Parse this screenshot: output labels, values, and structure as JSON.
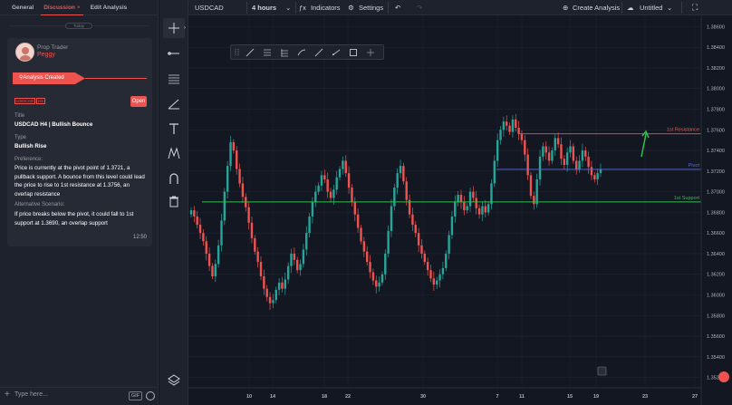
{
  "left_panel": {
    "tabs": [
      {
        "label": "General"
      },
      {
        "label": "Discussion",
        "close": "×"
      },
      {
        "label": "Edit Analysis"
      }
    ],
    "date_pill": "Today",
    "card": {
      "role": "Prop Trader",
      "username": "Peggy",
      "banner": "Analysis Created",
      "tags": [
        "USDCAD",
        "H4"
      ],
      "open_label": "Open",
      "title_label": "Title",
      "title_value": "USDCAD H4 | Bullish Bounce",
      "type_label": "Type",
      "type_value": "Bullish Rise",
      "preference_label": "Preference:",
      "preference_text": "Price is currently at the pivot point of 1.3721, a pullback support. A bounce from this level could lead the price to rise to 1st resistance at 1.3756, an overlap resistance",
      "alt_label": "Alternative Scenario:",
      "alt_text": "If price breaks below the pivot, it could fall to 1st support at 1.3690, an overlap support",
      "time": "12:50"
    },
    "input_placeholder": "Type here...",
    "gif_label": "GIF"
  },
  "topbar": {
    "symbol": "USDCAD",
    "interval": "4 hours",
    "indicators": "Indicators",
    "settings": "Settings",
    "create_analysis": "Create Analysis",
    "layout_name": "Untitled"
  },
  "chart_data": {
    "type": "candlestick",
    "symbol": "USDCAD",
    "interval": "4 hours",
    "y_ticks": [
      "1.38600",
      "1.38400",
      "1.38200",
      "1.38000",
      "1.37800",
      "1.37600",
      "1.37400",
      "1.37200",
      "1.37000",
      "1.36800",
      "1.36600",
      "1.36400",
      "1.36200",
      "1.36000",
      "1.35800",
      "1.35600",
      "1.35400",
      "1.35200"
    ],
    "x_ticks": [
      "10",
      "14",
      "18",
      "22",
      "30",
      "7",
      "11",
      "15",
      "19",
      "23",
      "27"
    ],
    "ylim": [
      1.351,
      1.387
    ],
    "levels": [
      {
        "name": "1st Resistance",
        "value": 1.37561,
        "label": "1.37561",
        "color": "#ef5350"
      },
      {
        "name": "Pivot",
        "value": 1.37217,
        "label": "1.37217",
        "color": "#5b6fd6"
      },
      {
        "name": "1st Support",
        "value": 1.36901,
        "label": "1.36901",
        "color": "#2ec24a"
      }
    ],
    "closes": [
      1.3682,
      1.3676,
      1.3668,
      1.366,
      1.3652,
      1.364,
      1.3628,
      1.3618,
      1.363,
      1.3648,
      1.3672,
      1.37,
      1.3725,
      1.3748,
      1.374,
      1.3722,
      1.3708,
      1.3695,
      1.3685,
      1.367,
      1.3655,
      1.3642,
      1.3632,
      1.3618,
      1.3606,
      1.3598,
      1.3592,
      1.3595,
      1.3605,
      1.3612,
      1.3606,
      1.3615,
      1.3628,
      1.364,
      1.3634,
      1.3624,
      1.363,
      1.3644,
      1.366,
      1.3676,
      1.369,
      1.37,
      1.3706,
      1.3716,
      1.3712,
      1.37,
      1.3694,
      1.3702,
      1.3714,
      1.3722,
      1.373,
      1.3718,
      1.3704,
      1.369,
      1.3678,
      1.3665,
      1.3652,
      1.3642,
      1.3632,
      1.3622,
      1.3614,
      1.3608,
      1.3612,
      1.362,
      1.364,
      1.3662,
      1.3686,
      1.3704,
      1.3718,
      1.3725,
      1.371,
      1.3692,
      1.3678,
      1.3668,
      1.366,
      1.3648,
      1.364,
      1.3632,
      1.3624,
      1.3616,
      1.361,
      1.3614,
      1.362,
      1.3626,
      1.364,
      1.3658,
      1.3676,
      1.369,
      1.3697,
      1.369,
      1.3682,
      1.3686,
      1.37,
      1.3694,
      1.3684,
      1.3678,
      1.3686,
      1.368,
      1.3688,
      1.3708,
      1.373,
      1.375,
      1.376,
      1.3768,
      1.3764,
      1.3758,
      1.377,
      1.3762,
      1.3756,
      1.375,
      1.3736,
      1.3716,
      1.3696,
      1.3688,
      1.3712,
      1.3734,
      1.3744,
      1.3738,
      1.373,
      1.374,
      1.3752,
      1.3746,
      1.3732,
      1.3726,
      1.3738,
      1.3744,
      1.373,
      1.3722,
      1.373,
      1.374,
      1.3734,
      1.3724,
      1.3716,
      1.3712,
      1.3718,
      1.3722
    ]
  }
}
